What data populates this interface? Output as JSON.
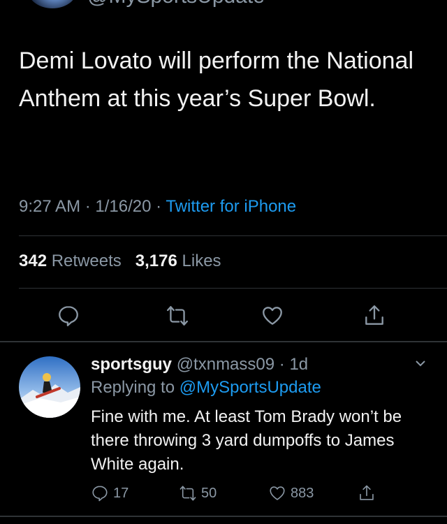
{
  "prev_header": {
    "handle": "@MySportsUpdate"
  },
  "tweet": {
    "text": "Demi Lovato will perform the National Anthem at this year’s Super Bowl.",
    "time": "9:27 AM",
    "date": "1/16/20",
    "separator": " · ",
    "source": "Twitter for iPhone",
    "retweets_count": "342",
    "retweets_label": "Retweets",
    "likes_count": "3,176",
    "likes_label": "Likes"
  },
  "actions": {
    "reply_icon": "reply-icon",
    "retweet_icon": "retweet-icon",
    "like_icon": "heart-icon",
    "share_icon": "share-icon"
  },
  "reply": {
    "name": "sportsguy",
    "handle": "@txnmass09",
    "separator": " · ",
    "age": "1d",
    "replying_prefix": "Replying to ",
    "replying_to": "@MySportsUpdate",
    "text": "Fine with me. At least Tom Brady won’t be there throwing 3 yard dumpoffs to James White again.",
    "reply_count": "17",
    "retweet_count": "50",
    "like_count": "883"
  },
  "colors": {
    "accent": "#1d9bf0",
    "background": "#000000",
    "muted": "#8b98a5"
  }
}
